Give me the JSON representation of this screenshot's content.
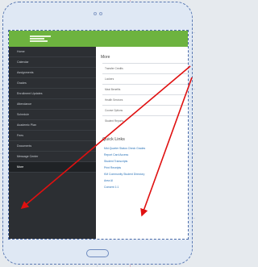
{
  "app": {
    "camera_dots": 2
  },
  "sidebar": {
    "items": [
      {
        "label": "Home",
        "active": false
      },
      {
        "label": "Calendar",
        "active": false
      },
      {
        "label": "Assignments",
        "active": false
      },
      {
        "label": "Grades",
        "active": false
      },
      {
        "label": "Enrollment Updates",
        "active": false
      },
      {
        "label": "Attendance",
        "active": false
      },
      {
        "label": "Schedule",
        "active": false
      },
      {
        "label": "Academic Plan",
        "active": false
      },
      {
        "label": "Fees",
        "active": false
      },
      {
        "label": "Documents",
        "active": false
      },
      {
        "label": "Message Center",
        "active": false
      },
      {
        "label": "More",
        "active": true
      }
    ]
  },
  "more": {
    "title": "More",
    "items": [
      "Transfer Credits",
      "Lockers",
      "Meal Benefits",
      "Health Services",
      "Course Options",
      "Student Reports"
    ]
  },
  "quick_links": {
    "title": "Quick Links",
    "items": [
      "Mid-Quarter Status Check Grades",
      "Report Card Access",
      "Student Transcripts",
      "Print Receipts",
      "KM Community Student Directory",
      "Area AI",
      "Consent 1:1"
    ]
  },
  "annotations": {
    "arrow_color": "#e01010"
  }
}
